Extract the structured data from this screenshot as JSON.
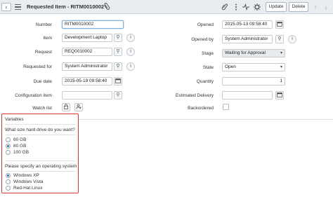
{
  "header": {
    "title": "Requested Item - RITM0010002",
    "update_label": "Update",
    "delete_label": "Delete"
  },
  "form": {
    "number": {
      "label": "Number",
      "value": "RITM0010002"
    },
    "item": {
      "label": "Item",
      "value": "Development Laptop"
    },
    "request": {
      "label": "Request",
      "value": "REQ0010002"
    },
    "requested_for": {
      "label": "Requested for",
      "value": "System Administrator"
    },
    "due_date": {
      "label": "Due date",
      "value": "2015-05-19 09:58:40"
    },
    "configuration_item": {
      "label": "Configuration item",
      "value": ""
    },
    "watch_list": {
      "label": "Watch list"
    },
    "opened": {
      "label": "Opened",
      "value": "2015-05-13 09:58:40"
    },
    "opened_by": {
      "label": "Opened by",
      "value": "System Administrator"
    },
    "stage": {
      "label": "Stage",
      "value": "Waiting for Approval"
    },
    "state": {
      "label": "State",
      "value": "Open"
    },
    "quantity": {
      "label": "Quantity",
      "value": "1"
    },
    "estimated_delivery": {
      "label": "Estimated Delivery",
      "value": ""
    },
    "backordered": {
      "label": "Backordered",
      "checked": false
    }
  },
  "variables": {
    "title": "Variables",
    "hard_drive": {
      "question": "What size hard drive do you want?",
      "options": [
        "60 GB",
        "80 GB",
        "100 GB"
      ],
      "selected": "80 GB"
    },
    "os": {
      "question": "Please specify an operating system",
      "options": [
        "Windows XP",
        "Windows Vista",
        "Red-Hat Linux"
      ],
      "selected": "Windows XP"
    }
  }
}
